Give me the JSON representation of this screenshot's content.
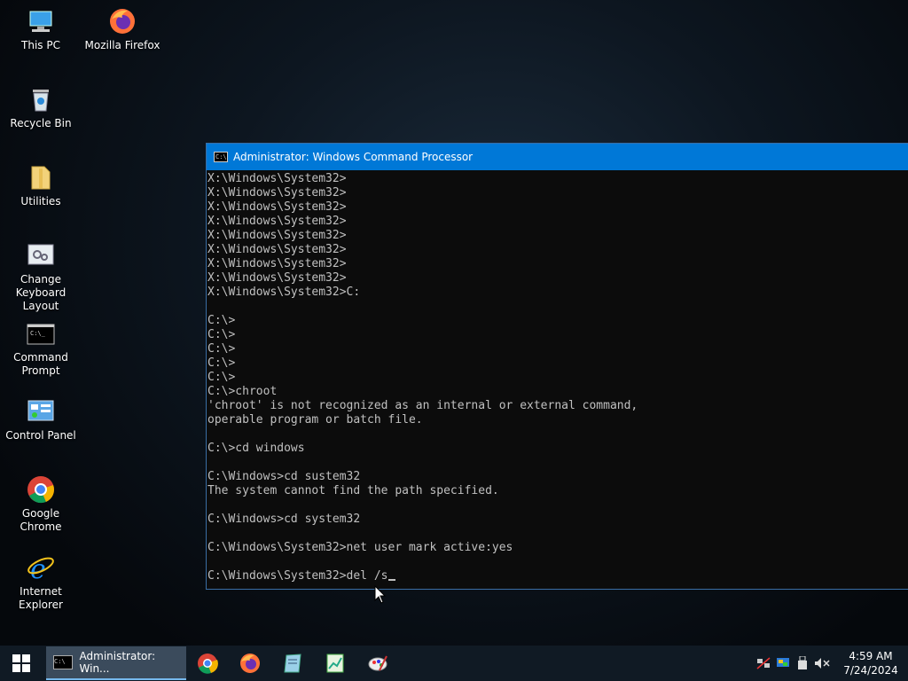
{
  "desktop": {
    "icons": [
      {
        "label": "This PC"
      },
      {
        "label": "Mozilla Firefox"
      },
      {
        "label": "Recycle Bin"
      },
      {
        "label": "Utilities"
      },
      {
        "label": "Change Keyboard Layout"
      },
      {
        "label": "Command Prompt"
      },
      {
        "label": "Control Panel"
      },
      {
        "label": "Google Chrome"
      },
      {
        "label": "Internet Explorer"
      }
    ]
  },
  "cmd_window": {
    "title": "Administrator: Windows Command Processor",
    "icon_text": "C:\\",
    "lines": [
      "X:\\Windows\\System32>",
      "X:\\Windows\\System32>",
      "X:\\Windows\\System32>",
      "X:\\Windows\\System32>",
      "X:\\Windows\\System32>",
      "X:\\Windows\\System32>",
      "X:\\Windows\\System32>",
      "X:\\Windows\\System32>",
      "X:\\Windows\\System32>C:",
      "",
      "C:\\>",
      "C:\\>",
      "C:\\>",
      "C:\\>",
      "C:\\>",
      "C:\\>chroot",
      "'chroot' is not recognized as an internal or external command,",
      "operable program or batch file.",
      "",
      "C:\\>cd windows",
      "",
      "C:\\Windows>cd sustem32",
      "The system cannot find the path specified.",
      "",
      "C:\\Windows>cd system32",
      "",
      "C:\\Windows\\System32>net user mark active:yes",
      "",
      "C:\\Windows\\System32>del /s"
    ]
  },
  "taskbar": {
    "active_task_label": "Administrator: Win...",
    "pinned": [
      "chrome-icon",
      "firefox-icon",
      "notepad-icon",
      "spreadsheet-icon",
      "paint-icon"
    ],
    "clock_time": "4:59 AM",
    "clock_date": "7/24/2024"
  },
  "colors": {
    "titlebar": "#0078d7",
    "console_bg": "#0c0c0c",
    "console_fg": "#c0c0c0",
    "taskbar": "#101a24"
  }
}
